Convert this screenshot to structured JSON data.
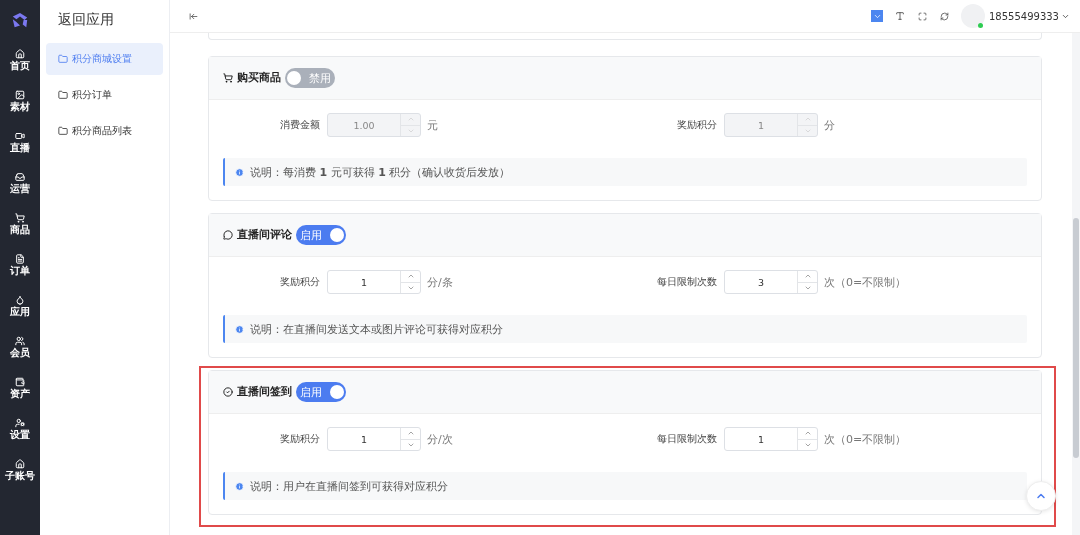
{
  "rail": {
    "items": [
      {
        "label": "首页"
      },
      {
        "label": "素材"
      },
      {
        "label": "直播"
      },
      {
        "label": "运营"
      },
      {
        "label": "商品"
      },
      {
        "label": "订单"
      },
      {
        "label": "应用"
      },
      {
        "label": "会员"
      },
      {
        "label": "资产"
      },
      {
        "label": "设置"
      },
      {
        "label": "子账号"
      }
    ]
  },
  "sidebar": {
    "title": "返回应用",
    "items": [
      {
        "label": "积分商城设置",
        "selected": true
      },
      {
        "label": "积分订单",
        "selected": false
      },
      {
        "label": "积分商品列表",
        "selected": false
      }
    ]
  },
  "topbar": {
    "user": "18555499333"
  },
  "sections": [
    {
      "kind": "cart",
      "title": "购买商品",
      "enabled": false,
      "toggle_label": "禁用",
      "highlighted": false,
      "fields": [
        {
          "label": "消费金额",
          "value": "1.00",
          "unit": "元"
        },
        {
          "label": "奖励积分",
          "value": "1",
          "unit": "分"
        }
      ],
      "note": "说明：每消费 **1** 元可获得 **1** 积分（确认收货后发放）"
    },
    {
      "kind": "comment",
      "title": "直播间评论",
      "enabled": true,
      "toggle_label": "启用",
      "highlighted": false,
      "fields": [
        {
          "label": "奖励积分",
          "value": "1",
          "unit": "分/条"
        },
        {
          "label": "每日限制次数",
          "value": "3",
          "unit": "次（0=不限制）"
        }
      ],
      "note": "说明：在直播间发送文本或图片评论可获得对应积分"
    },
    {
      "kind": "check",
      "title": "直播间签到",
      "enabled": true,
      "toggle_label": "启用",
      "highlighted": true,
      "fields": [
        {
          "label": "奖励积分",
          "value": "1",
          "unit": "分/次"
        },
        {
          "label": "每日限制次数",
          "value": "1",
          "unit": "次（0=不限制）"
        }
      ],
      "note": "说明：用户在直播间签到可获得对应积分"
    }
  ]
}
